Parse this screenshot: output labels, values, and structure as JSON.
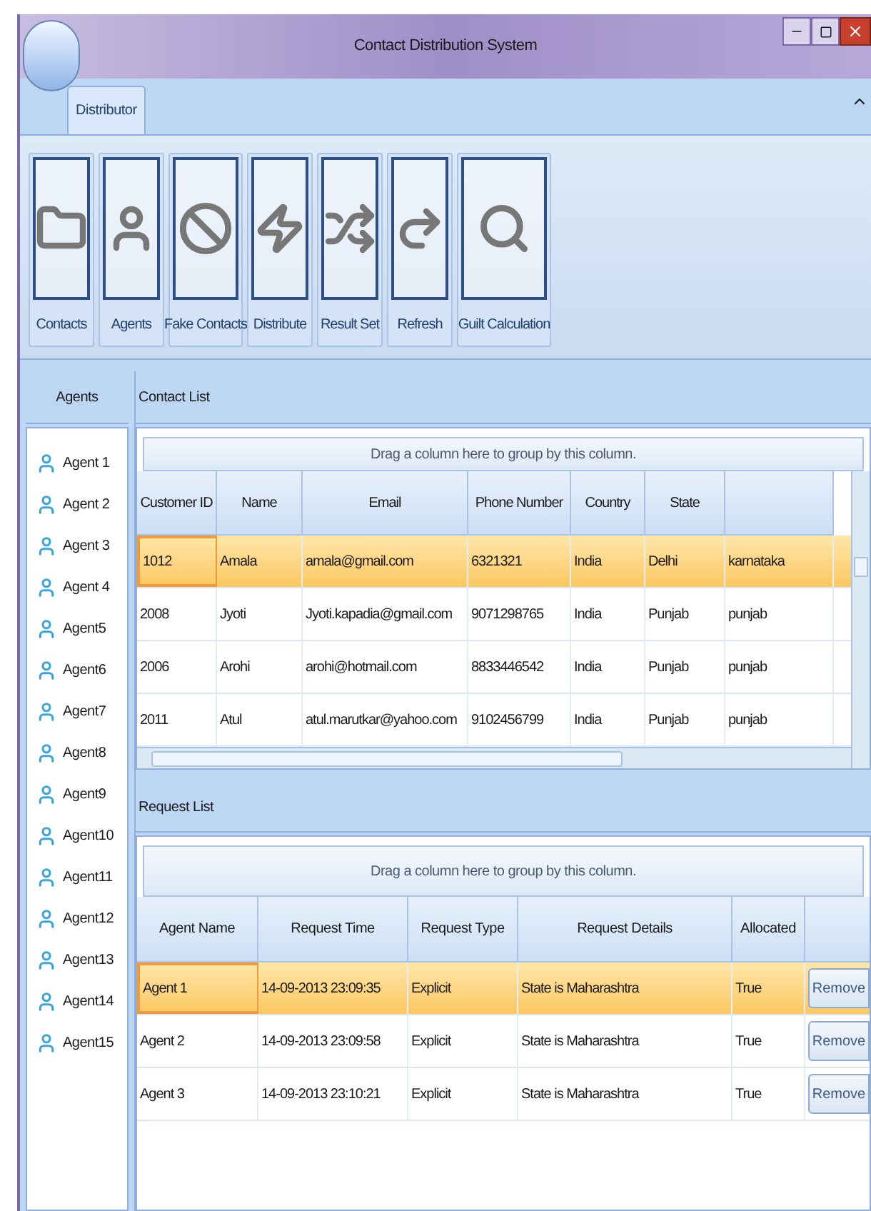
{
  "window": {
    "title": "Contact Distribution System"
  },
  "ribbon": {
    "tabs": [
      {
        "label": "Distributor",
        "selected": true
      }
    ],
    "buttons": [
      {
        "label": "Contacts"
      },
      {
        "label": "Agents"
      },
      {
        "label": "Fake Contacts"
      },
      {
        "label": "Distribute"
      },
      {
        "label": "Result Set"
      },
      {
        "label": "Refresh"
      },
      {
        "label": "Guilt Calculation"
      }
    ]
  },
  "agents_panel": {
    "title": "Agents",
    "agents": [
      "Agent 1",
      "Agent 2",
      "Agent 3",
      "Agent 4",
      "Agent5",
      "Agent6",
      "Agent7",
      "Agent8",
      "Agent9",
      "Agent10",
      "Agent11",
      "Agent12",
      "Agent13",
      "Agent14",
      "Agent15"
    ]
  },
  "contact_list": {
    "title": "Contact List",
    "group_hint": "Drag a column here to group by this column.",
    "columns": [
      "Customer ID",
      "Name",
      "Email",
      "Phone Number",
      "Country",
      "State",
      ""
    ],
    "rows": [
      {
        "selected": true,
        "cells": [
          "1012",
          "Amala",
          "amala@gmail.com",
          "6321321",
          "India",
          "Delhi",
          "karnataka"
        ]
      },
      {
        "selected": false,
        "cells": [
          "2008",
          "Jyoti",
          "Jyoti.kapadia@gmail.com",
          "9071298765",
          "India",
          "Punjab",
          "punjab"
        ]
      },
      {
        "selected": false,
        "cells": [
          "2006",
          "Arohi",
          "arohi@hotmail.com",
          "8833446542",
          "India",
          "Punjab",
          "punjab"
        ]
      },
      {
        "selected": false,
        "cells": [
          "2011",
          "Atul",
          "atul.marutkar@yahoo.com",
          "9102456799",
          "India",
          "Punjab",
          "punjab"
        ]
      }
    ]
  },
  "request_list": {
    "title": "Request List",
    "group_hint": "Drag a column here to group by this column.",
    "columns": [
      "Agent Name",
      "Request Time",
      "Request Type",
      "Request Details",
      "Allocated"
    ],
    "rows": [
      {
        "selected": true,
        "cells": [
          "Agent 1",
          "14-09-2013 23:09:35",
          "Explicit",
          "State is Maharashtra",
          "True"
        ],
        "button": "Remove"
      },
      {
        "selected": false,
        "cells": [
          "Agent 2",
          "14-09-2013 23:09:58",
          "Explicit",
          "State is Maharashtra",
          "True"
        ],
        "button": "Remove"
      },
      {
        "selected": false,
        "cells": [
          "Agent 3",
          "14-09-2013 23:10:21",
          "Explicit",
          "State is Maharashtra",
          "True"
        ],
        "button": "Remove"
      }
    ]
  }
}
